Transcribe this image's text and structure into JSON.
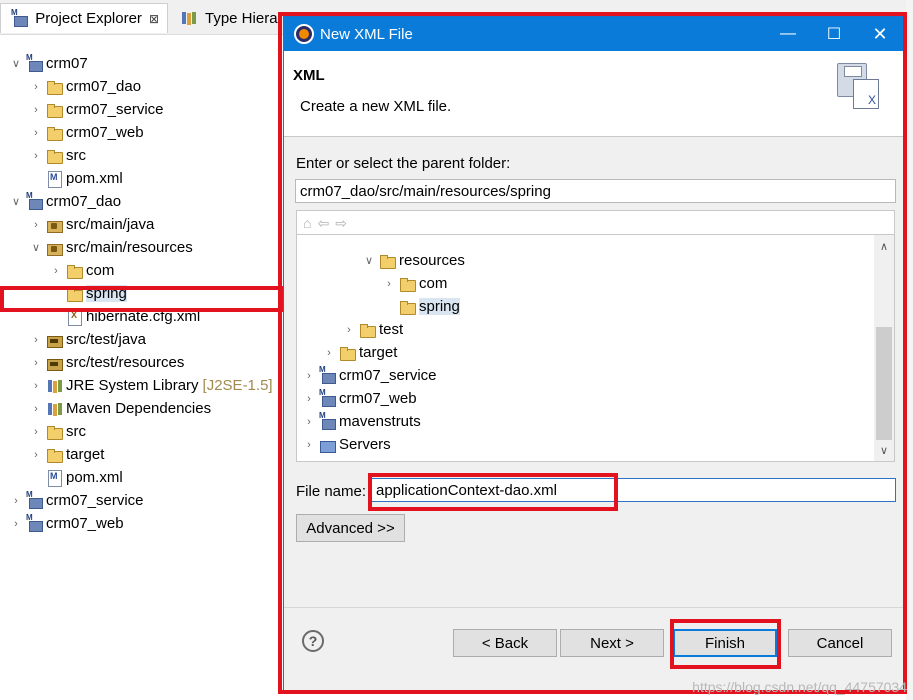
{
  "explorer": {
    "tab_active": "Project Explorer",
    "tab_inactive": "Type Hierar",
    "tab_close": "⊠",
    "tree": [
      {
        "label": "crm07",
        "chev": "∨",
        "icon": "project",
        "decor": ""
      },
      {
        "label": "crm07_dao",
        "chev": "›",
        "icon": "folder",
        "decor": ""
      },
      {
        "label": "crm07_service",
        "chev": "›",
        "icon": "folder",
        "decor": ""
      },
      {
        "label": "crm07_web",
        "chev": "›",
        "icon": "folder",
        "decor": ""
      },
      {
        "label": "src",
        "chev": "›",
        "icon": "folder",
        "decor": ""
      },
      {
        "label": "pom.xml",
        "chev": "",
        "icon": "xmlfile",
        "decor": ""
      },
      {
        "label": "crm07_dao",
        "chev": "∨",
        "icon": "project",
        "decor": ""
      },
      {
        "label": "src/main/java",
        "chev": "›",
        "icon": "srcfolder",
        "decor": ""
      },
      {
        "label": "src/main/resources",
        "chev": "∨",
        "icon": "srcfolder",
        "decor": ""
      },
      {
        "label": "com",
        "chev": "›",
        "icon": "folder",
        "decor": ""
      },
      {
        "label": "spring",
        "chev": "",
        "icon": "folder",
        "decor": ""
      },
      {
        "label": "hibernate.cfg.xml",
        "chev": "",
        "icon": "cfgfile",
        "decor": ""
      },
      {
        "label": "src/test/java",
        "chev": "›",
        "icon": "pkgfolder",
        "decor": ""
      },
      {
        "label": "src/test/resources",
        "chev": "›",
        "icon": "pkgfolder",
        "decor": ""
      },
      {
        "label": "JRE System Library",
        "chev": "›",
        "icon": "library",
        "decor": "[J2SE-1.5]"
      },
      {
        "label": "Maven Dependencies",
        "chev": "›",
        "icon": "library",
        "decor": ""
      },
      {
        "label": "src",
        "chev": "›",
        "icon": "folder",
        "decor": ""
      },
      {
        "label": "target",
        "chev": "›",
        "icon": "folder",
        "decor": ""
      },
      {
        "label": "pom.xml",
        "chev": "",
        "icon": "xmlfile",
        "decor": ""
      },
      {
        "label": "crm07_service",
        "chev": "›",
        "icon": "project",
        "decor": ""
      },
      {
        "label": "crm07_web",
        "chev": "›",
        "icon": "project",
        "decor": ""
      }
    ]
  },
  "dialog": {
    "title": "New XML File",
    "min": "—",
    "max": "☐",
    "close": "✕",
    "banner_heading": "XML",
    "banner_desc": "Create a new XML file.",
    "banner_icon_letter": "X",
    "parent_label": "Enter or select the parent folder:",
    "parent_value": "crm07_dao/src/main/resources/spring",
    "nav_home": "⌂",
    "nav_back": "⇦",
    "nav_fwd": "⇨",
    "tree": [
      {
        "label": "resources",
        "chev": "∨",
        "icon": "folder"
      },
      {
        "label": "com",
        "chev": "›",
        "icon": "folder"
      },
      {
        "label": "spring",
        "chev": "",
        "icon": "folder"
      },
      {
        "label": "test",
        "chev": "›",
        "icon": "folder"
      },
      {
        "label": "target",
        "chev": "›",
        "icon": "folder"
      },
      {
        "label": "crm07_service",
        "chev": "›",
        "icon": "project"
      },
      {
        "label": "crm07_web",
        "chev": "›",
        "icon": "project"
      },
      {
        "label": "mavenstruts",
        "chev": "›",
        "icon": "project"
      },
      {
        "label": "Servers",
        "chev": "›",
        "icon": "server"
      }
    ],
    "scroll_up": "∧",
    "scroll_down": "∨",
    "filename_label": "File name:",
    "filename_value": "applicationContext-dao.xml",
    "advanced": "Advanced >>",
    "help": "?",
    "back": "< Back",
    "next": "Next >",
    "finish": "Finish",
    "cancel": "Cancel"
  },
  "watermark": "https://blog.csdn.net/qq_44757034"
}
